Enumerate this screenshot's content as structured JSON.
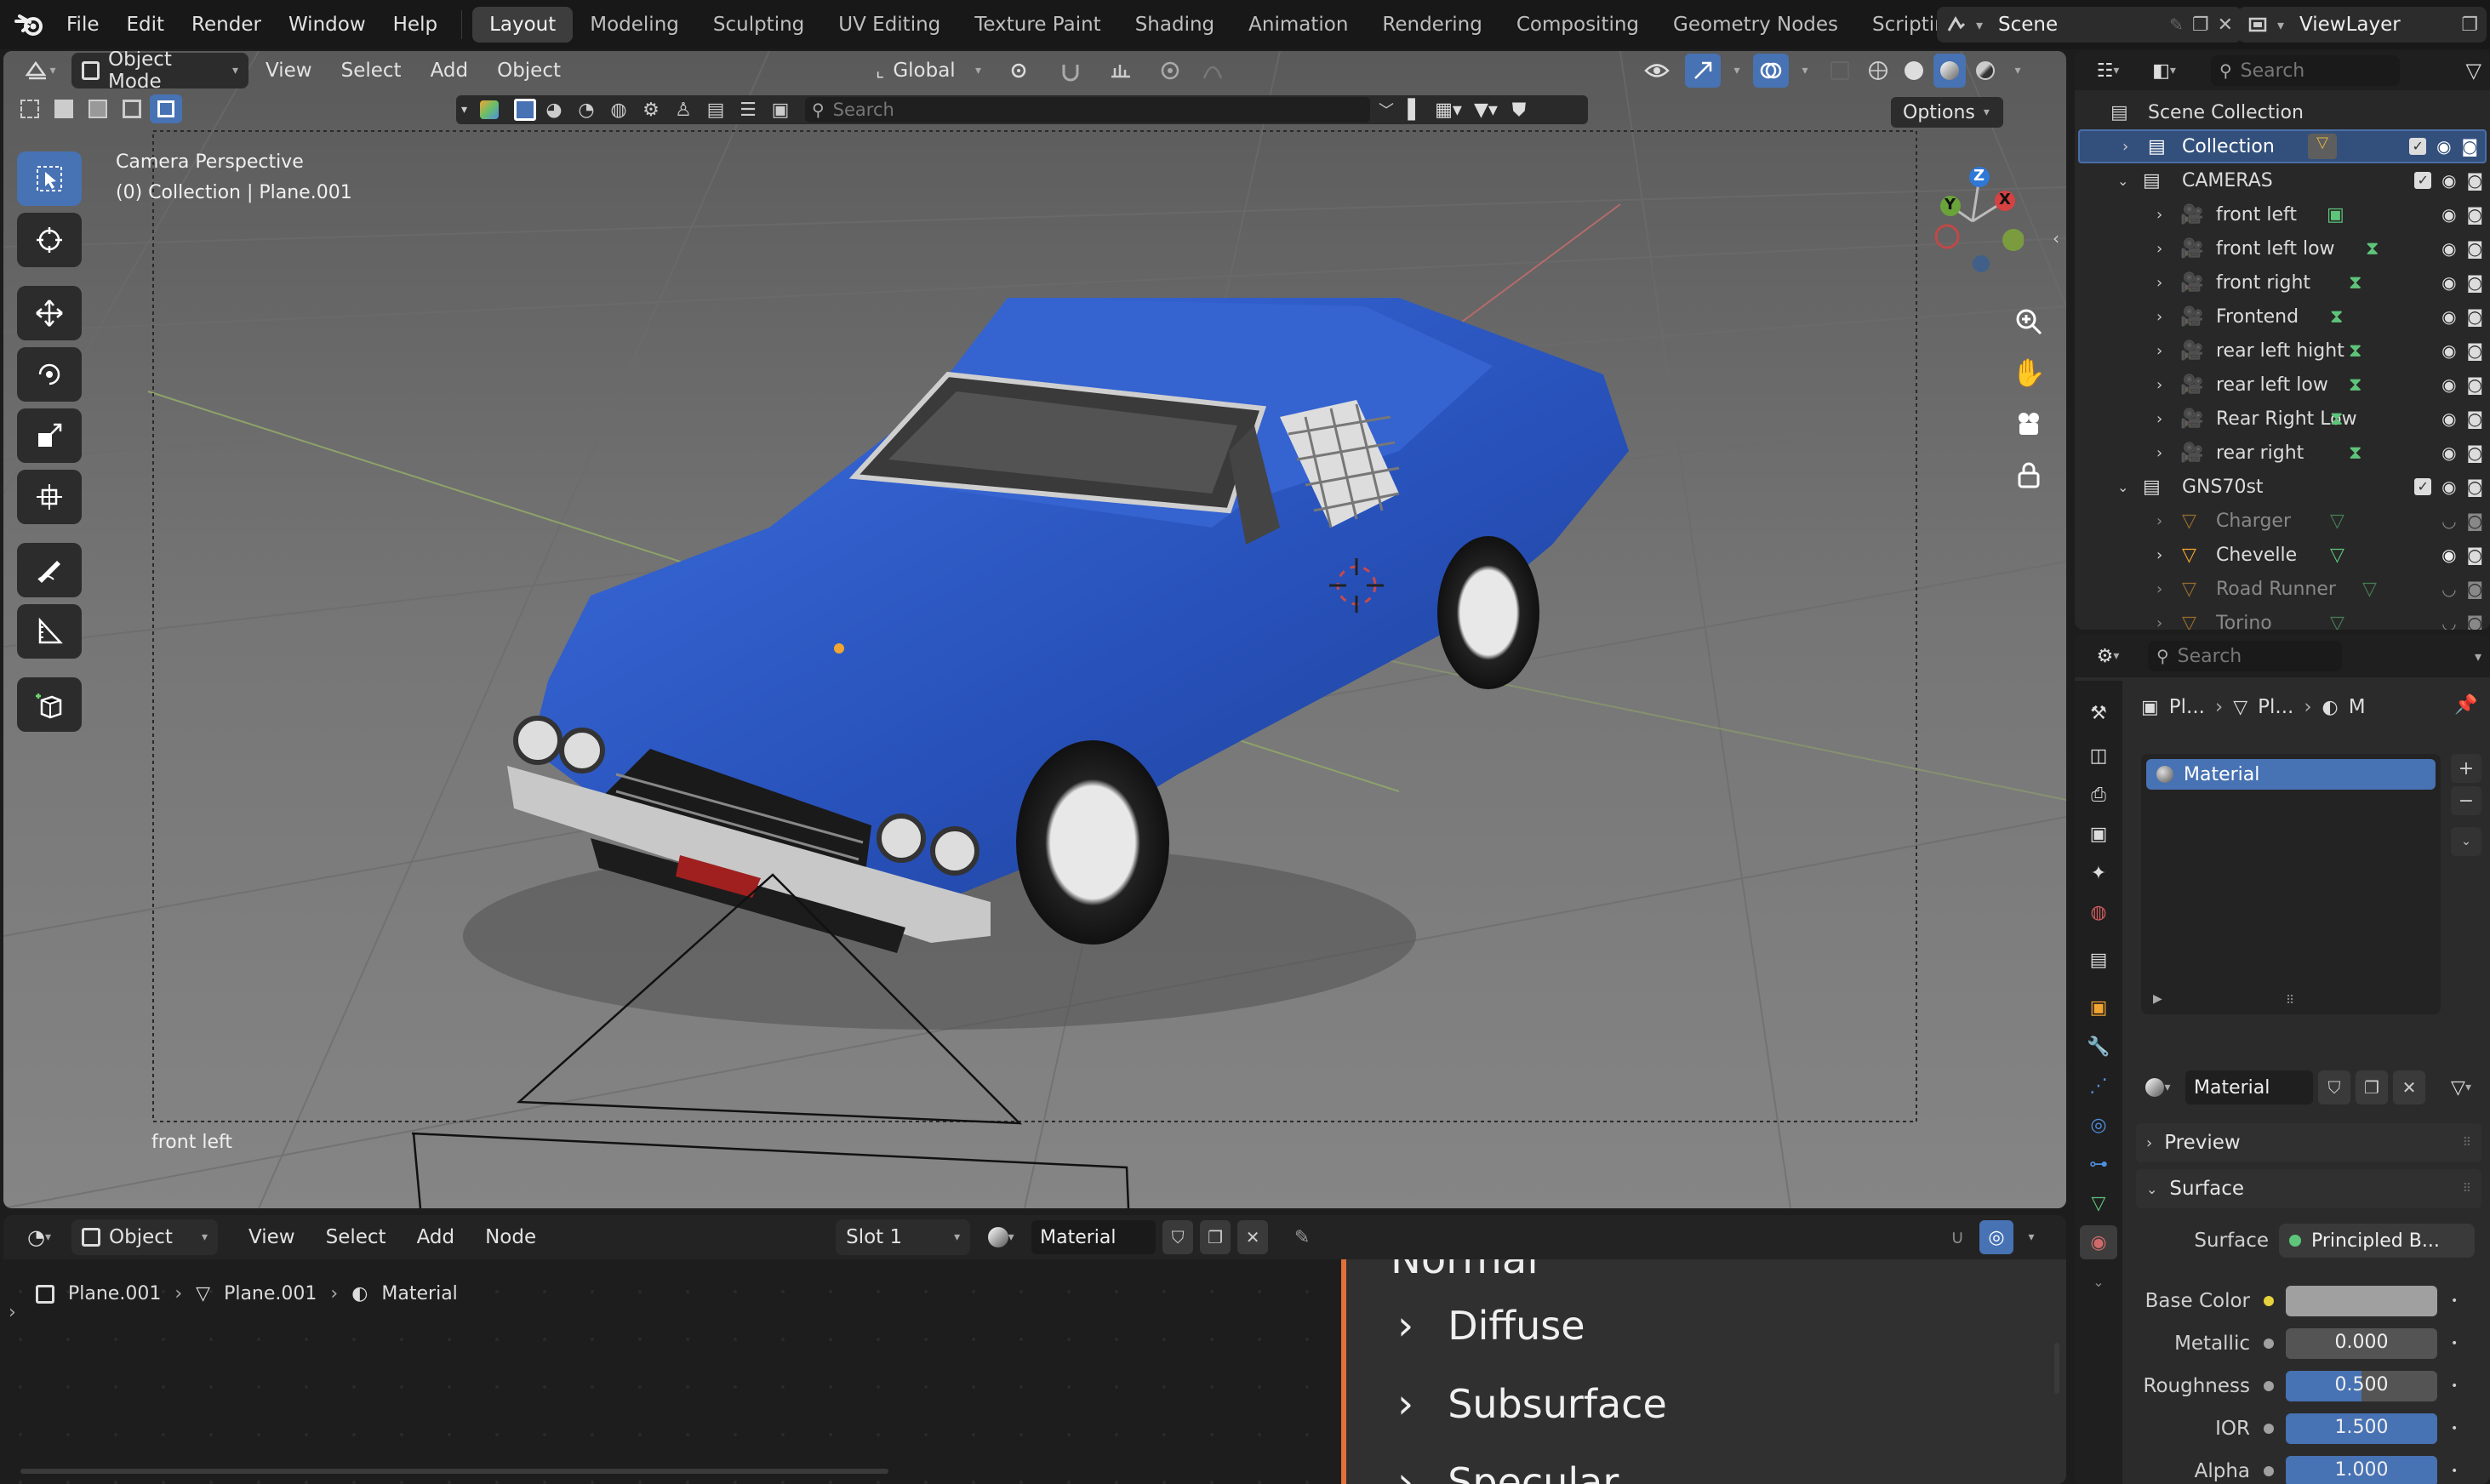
{
  "topbar": {
    "menus": [
      "File",
      "Edit",
      "Render",
      "Window",
      "Help"
    ],
    "workspaces": [
      "Layout",
      "Modeling",
      "Sculpting",
      "UV Editing",
      "Texture Paint",
      "Shading",
      "Animation",
      "Rendering",
      "Compositing",
      "Geometry Nodes",
      "Scripting"
    ],
    "active_workspace": "Layout",
    "scene": "Scene",
    "view_layer": "ViewLayer"
  },
  "viewport": {
    "mode": "Object Mode",
    "menus": [
      "View",
      "Select",
      "Add",
      "Object"
    ],
    "orientation": "Global",
    "options_label": "Options",
    "search_placeholder": "Search",
    "overlay_title": "Camera Perspective",
    "overlay_subtitle": "(0) Collection | Plane.001",
    "camera_name": "front left",
    "gizmo_axes": {
      "z": "Z",
      "y": "Y",
      "x": "X"
    }
  },
  "outliner": {
    "search_placeholder": "Search",
    "root": "Scene Collection",
    "items": [
      {
        "label": "Collection",
        "type": "collection",
        "selected": true
      },
      {
        "label": "CAMERAS",
        "type": "collection"
      },
      {
        "label": "front left",
        "type": "camera"
      },
      {
        "label": "front left low",
        "type": "camera"
      },
      {
        "label": "front right",
        "type": "camera"
      },
      {
        "label": "Frontend",
        "type": "camera"
      },
      {
        "label": "rear left hight",
        "type": "camera"
      },
      {
        "label": "rear left low",
        "type": "camera"
      },
      {
        "label": "Rear Right Low",
        "type": "camera"
      },
      {
        "label": "rear right",
        "type": "camera"
      },
      {
        "label": "GNS70st",
        "type": "collection"
      },
      {
        "label": "Charger",
        "type": "mesh",
        "hidden": true
      },
      {
        "label": "Chevelle",
        "type": "mesh"
      },
      {
        "label": "Road Runner",
        "type": "mesh",
        "hidden": true
      },
      {
        "label": "Torino",
        "type": "mesh",
        "hidden": true
      }
    ]
  },
  "properties": {
    "search_placeholder": "Search",
    "breadcrumb": [
      "Pl...",
      "Pl...",
      "M"
    ],
    "material_slot": "Material",
    "material_name": "Material",
    "panels": {
      "preview": "Preview",
      "surface": "Surface"
    },
    "surface_label": "Surface",
    "surface_value": "Principled B...",
    "fields": [
      {
        "label": "Base Color",
        "value": ""
      },
      {
        "label": "Metallic",
        "value": "0.000"
      },
      {
        "label": "Roughness",
        "value": "0.500",
        "fill": 0.5
      },
      {
        "label": "IOR",
        "value": "1.500",
        "fill": 1.0
      },
      {
        "label": "Alpha",
        "value": "1.000",
        "fill": 1.0
      }
    ]
  },
  "node_editor": {
    "object_menu": "Object",
    "menus": [
      "View",
      "Select",
      "Add",
      "Node"
    ],
    "slot": "Slot 1",
    "material": "Material",
    "breadcrumb": [
      "Plane.001",
      "Plane.001",
      "Material"
    ],
    "node_partial_label": "Normal",
    "sockets": [
      "Diffuse",
      "Subsurface",
      "Specular"
    ]
  }
}
